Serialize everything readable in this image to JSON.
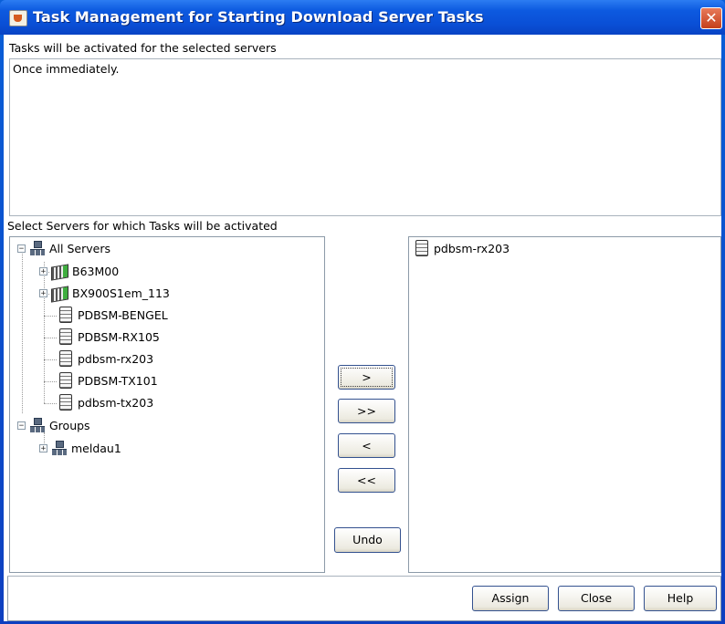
{
  "window": {
    "title": "Task Management for Starting Download Server Tasks",
    "close_glyph": "✕"
  },
  "activation": {
    "label": "Tasks will be activated for the selected servers",
    "text": "Once immediately."
  },
  "servers": {
    "label": "Select Servers for which Tasks will be activated",
    "tree": {
      "all_servers": "All Servers",
      "items": [
        "B63M00",
        "BX900S1em_113",
        "PDBSM-BENGEL",
        "PDBSM-RX105",
        "pdbsm-rx203",
        "PDBSM-TX101",
        "pdbsm-tx203"
      ],
      "groups": "Groups",
      "group_items": [
        "meldau1"
      ]
    },
    "selected": [
      "pdbsm-rx203"
    ]
  },
  "transfer_buttons": {
    "add": ">",
    "add_all": ">>",
    "remove": "<",
    "remove_all": "<<",
    "undo": "Undo"
  },
  "footer": {
    "assign": "Assign",
    "close": "Close",
    "help": "Help"
  },
  "icons": {
    "app": "java-cup-icon",
    "network": "network-icon",
    "rack": "server-rack-icon",
    "server": "server-icon"
  }
}
